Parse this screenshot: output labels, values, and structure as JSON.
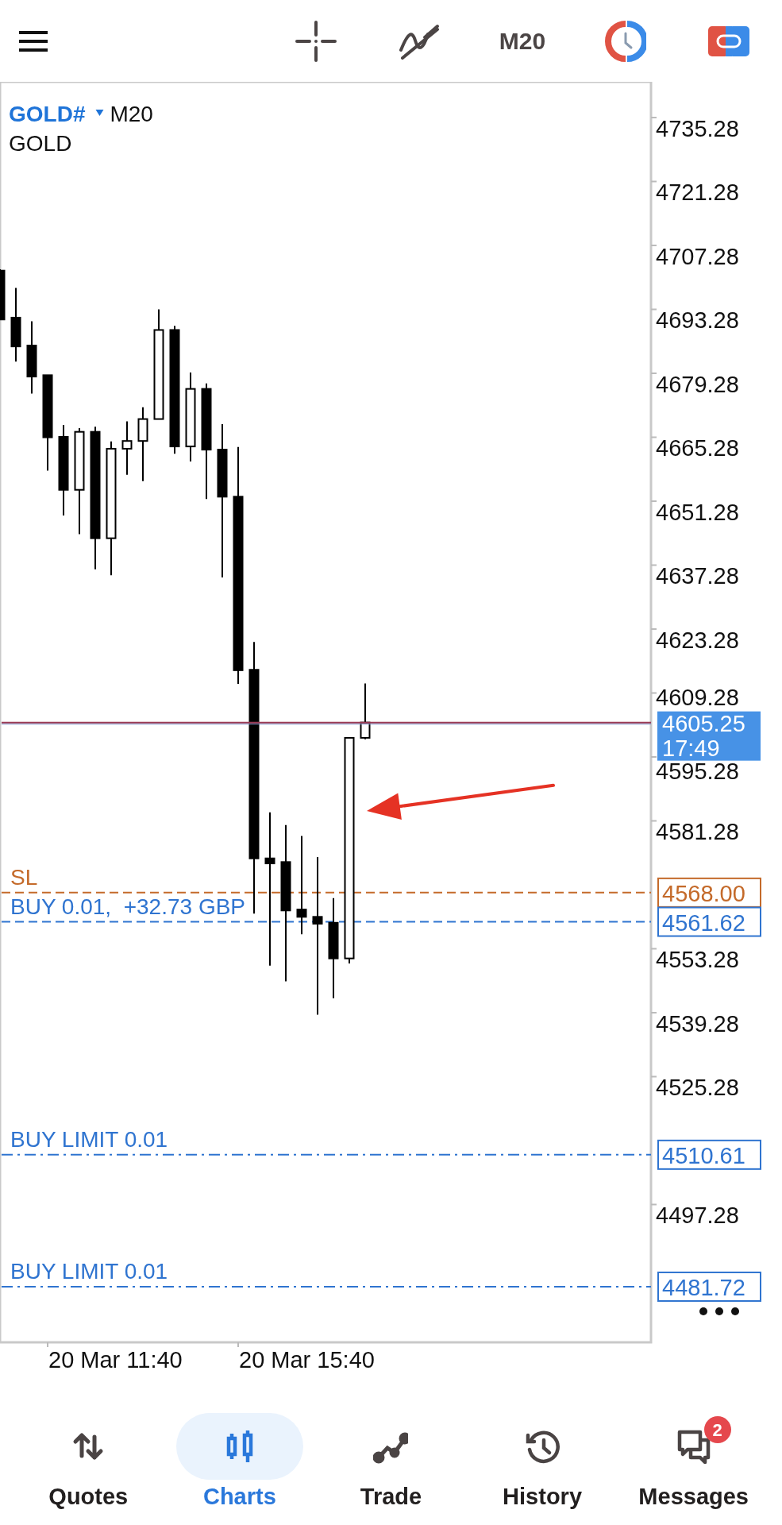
{
  "toolbar": {
    "timeframe": "M20"
  },
  "symbol": {
    "name": "GOLD#",
    "timeframe": "M20",
    "description": "GOLD"
  },
  "chart": {
    "price_axis": [
      "4735.28",
      "4721.28",
      "4707.28",
      "4693.28",
      "4679.28",
      "4665.28",
      "4651.28",
      "4637.28",
      "4623.28",
      "4609.28",
      "4595.28",
      "4581.28",
      "4553.28",
      "4539.28",
      "4525.28",
      "4497.28"
    ],
    "time_axis": [
      "20 Mar 11:40",
      "20 Mar 15:40"
    ],
    "current_price": {
      "price": "4605.25",
      "countdown": "17:49"
    },
    "order_lines": [
      {
        "kind": "sl",
        "label": "SL",
        "price": "4568.00"
      },
      {
        "kind": "position",
        "label": "BUY 0.01,  +32.73 GBP",
        "price": "4561.62"
      },
      {
        "kind": "limit",
        "label": "BUY LIMIT 0.01",
        "price": "4510.61"
      },
      {
        "kind": "limit",
        "label": "BUY LIMIT 0.01",
        "price": "4481.72"
      }
    ]
  },
  "nav": [
    {
      "kind": "quotes",
      "label": "Quotes",
      "selected": false
    },
    {
      "kind": "charts",
      "label": "Charts",
      "selected": true
    },
    {
      "kind": "trade",
      "label": "Trade",
      "selected": false
    },
    {
      "kind": "history",
      "label": "History",
      "selected": false
    },
    {
      "kind": "messages",
      "label": "Messages",
      "selected": false,
      "badge": "2"
    }
  ]
}
